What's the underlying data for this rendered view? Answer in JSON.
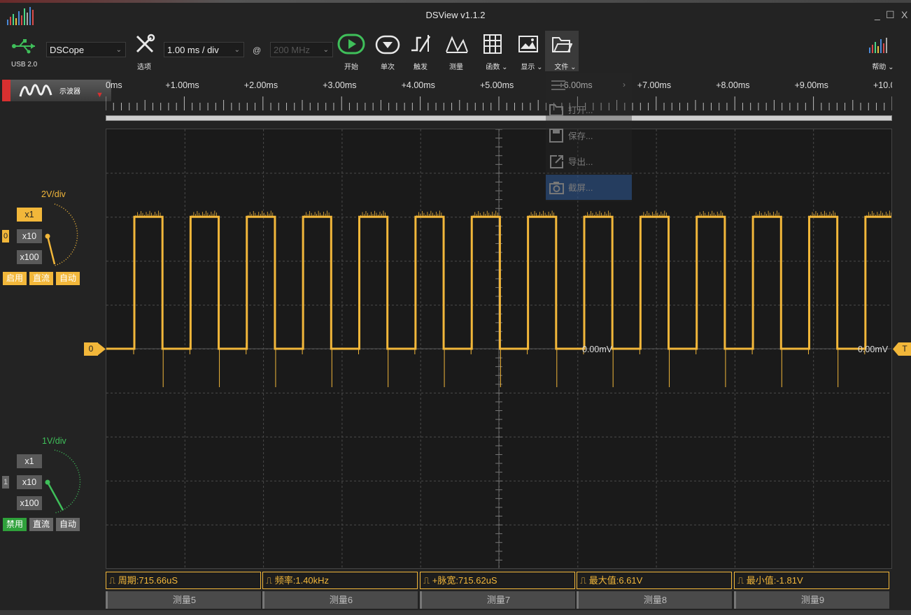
{
  "window": {
    "title": "DSView v1.1.2",
    "controls": [
      "_",
      "☐",
      "X"
    ]
  },
  "toolbar": {
    "usb_label": "USB 2.0",
    "device": "DSCope",
    "options_label": "选项",
    "timebase": "1.00 ms / div",
    "at": "@",
    "samplerate": "200 MHz",
    "start_label": "开始",
    "single_label": "单次",
    "trigger_label": "触发",
    "measure_label": "测量",
    "function_label": "函数",
    "display_label": "显示",
    "file_label": "文件",
    "help_label": "帮助"
  },
  "mode_tab": {
    "label": "示波器"
  },
  "ruler": {
    "ticks": [
      "0ms",
      "+1.00ms",
      "+2.00ms",
      "+3.00ms",
      "+4.00ms",
      "+5.00ms",
      "+6.00ms",
      "+7.00ms",
      "+8.00ms",
      "+9.00ms",
      "+10.0"
    ]
  },
  "file_menu": {
    "items": [
      "打开...",
      "保存...",
      "导出...",
      "截屏..."
    ],
    "highlighted": "截屏..."
  },
  "channels": [
    {
      "index": "0",
      "vdiv": "2V/div",
      "scales": [
        "x1",
        "x10",
        "x100"
      ],
      "active_scale": "x1",
      "enable": "启用",
      "coupling": "直流",
      "auto": "自动",
      "color": "#f2b73a"
    },
    {
      "index": "1",
      "vdiv": "1V/div",
      "scales": [
        "x1",
        "x10",
        "x100"
      ],
      "active_scale": "x1",
      "enable": "禁用",
      "coupling": "直流",
      "auto": "自动",
      "color": "#2fa13b"
    }
  ],
  "plot": {
    "ch0_marker": "0",
    "trigger_marker": "T",
    "offset_left": "0.00mV",
    "offset_right": "0.00mV"
  },
  "measurements": [
    "周期:715.66uS",
    "频率:1.40kHz",
    "+脉宽:715.62uS",
    "最大值:6.61V",
    "最小值:-1.81V"
  ],
  "measure_slots": [
    "测量5",
    "测量6",
    "测量7",
    "测量8",
    "测量9"
  ],
  "waveform": {
    "period_ms": 0.7157,
    "high_v": 6.0,
    "low_v": 0.0,
    "color": "#f2b73a"
  }
}
